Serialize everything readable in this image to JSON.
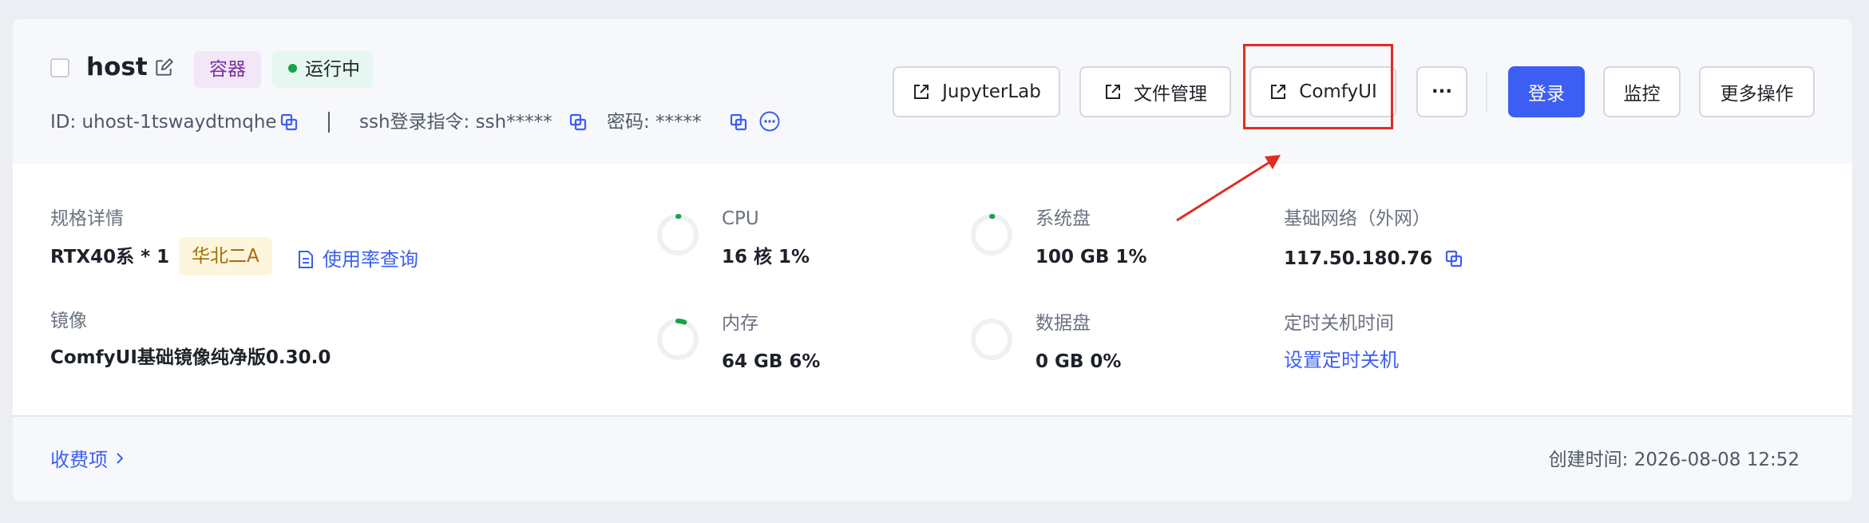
{
  "instance": {
    "name": "host",
    "type_tag": "容器",
    "status": "运行中",
    "id_text": "ID: uhost-1tswaydtmqhe",
    "ssh_text": "ssh登录指令: ssh*****",
    "password_text": "密码: *****"
  },
  "actions": {
    "jupyterlab": "JupyterLab",
    "file_manager": "文件管理",
    "comfyui": "ComfyUI",
    "more_dots": "···",
    "login": "登录",
    "monitor": "监控",
    "more_ops": "更多操作"
  },
  "spec": {
    "label": "规格详情",
    "value": "RTX40系 * 1",
    "region": "华北二A",
    "usage_link": "使用率查询"
  },
  "image": {
    "label": "镜像",
    "value": "ComfyUI基础镜像纯净版0.30.0"
  },
  "cpu": {
    "label": "CPU",
    "value": "16 核 1%",
    "usage": 1
  },
  "memory": {
    "label": "内存",
    "value": "64 GB 6%",
    "usage": 6
  },
  "system_disk": {
    "label": "系统盘",
    "value": "100 GB 1%",
    "usage": 1
  },
  "data_disk": {
    "label": "数据盘",
    "value": "0 GB 0%",
    "usage": 0
  },
  "network": {
    "label": "基础网络（外网）",
    "value": "117.50.180.76"
  },
  "shutdown": {
    "label": "定时关机时间",
    "link": "设置定时关机"
  },
  "footer": {
    "billing_link": "收费项",
    "created": "创建时间: 2026-08-08 12:52"
  },
  "colors": {
    "primary": "#3c5ef2",
    "running_dot": "#16a34a",
    "highlight": "#e12c23"
  }
}
